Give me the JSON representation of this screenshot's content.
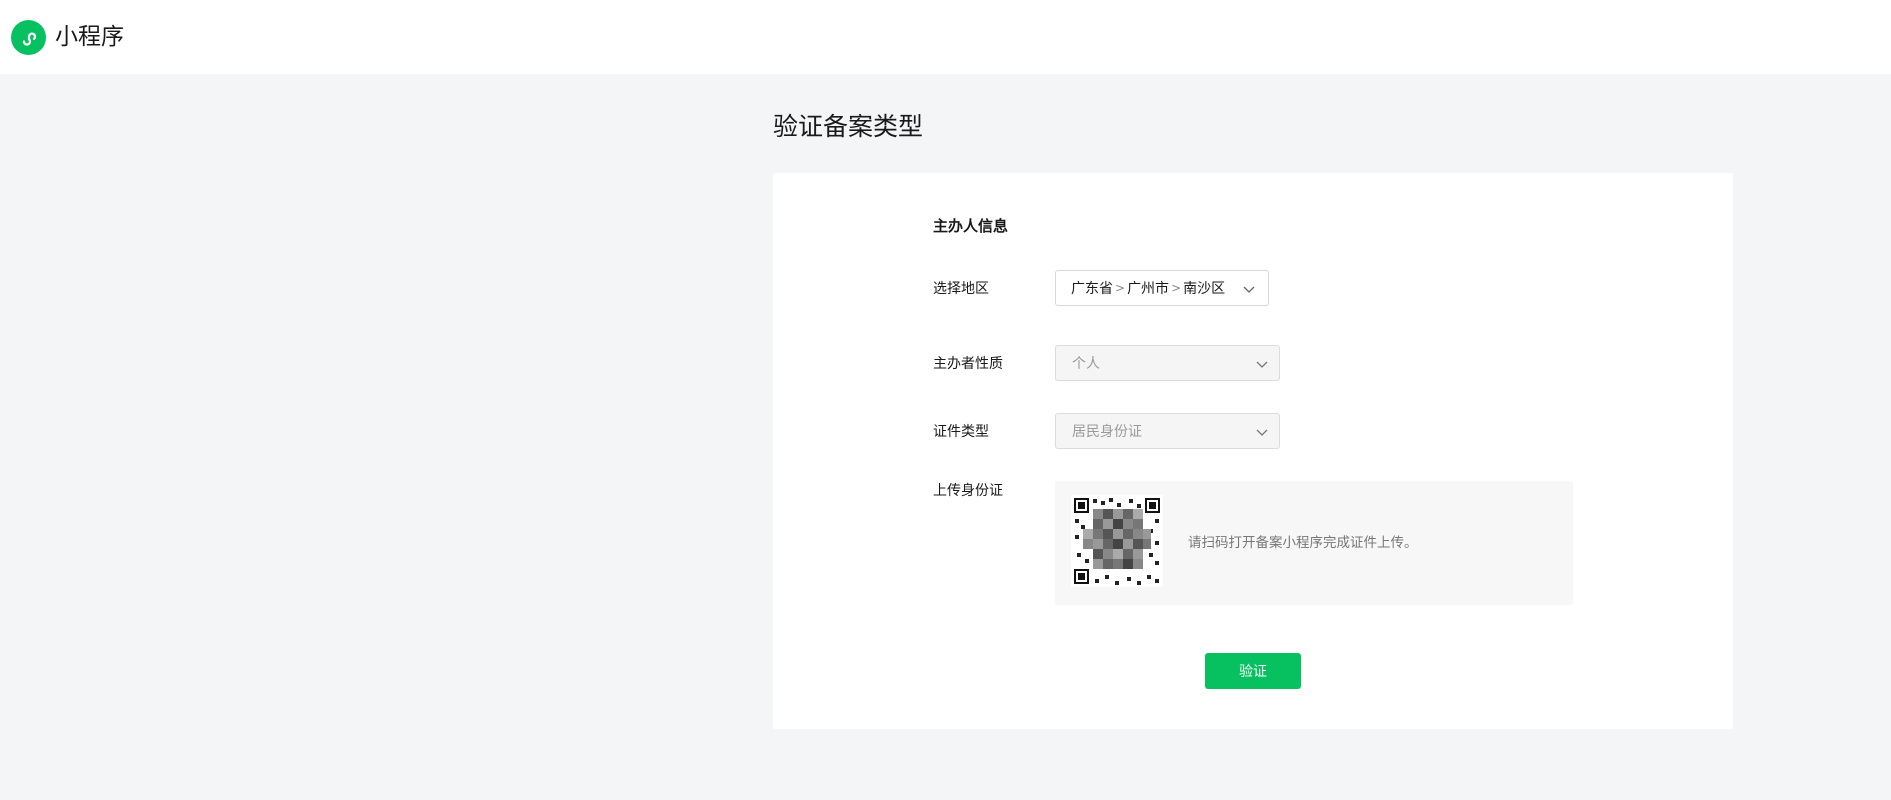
{
  "header": {
    "app_name": "小程序",
    "logo_icon": "miniprogram-logo-icon",
    "brand_color": "#07c160"
  },
  "page": {
    "title": "验证备案类型"
  },
  "form": {
    "section_title": "主办人信息",
    "region": {
      "label": "选择地区",
      "province": "广东省",
      "city": "广州市",
      "district": "南沙区",
      "separator": ">"
    },
    "organizer_type": {
      "label": "主办者性质",
      "value": "个人",
      "disabled": true
    },
    "id_type": {
      "label": "证件类型",
      "value": "居民身份证",
      "disabled": true
    },
    "upload": {
      "label": "上传身份证",
      "hint": "请扫码打开备案小程序完成证件上传。",
      "qr_icon": "qr-code-icon"
    },
    "submit_label": "验证"
  }
}
